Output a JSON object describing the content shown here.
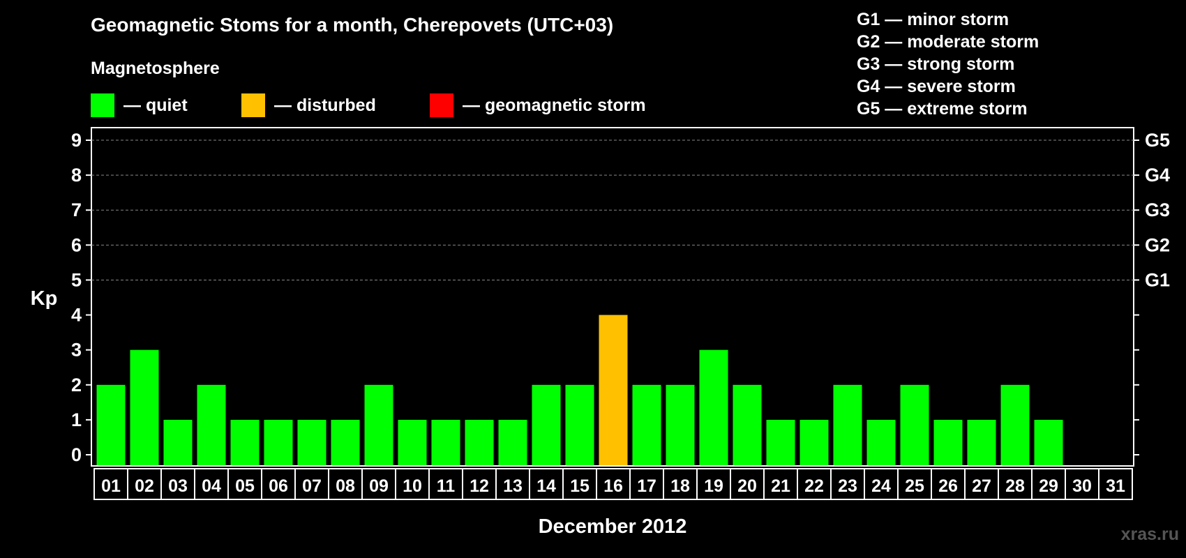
{
  "header": {
    "title": "Geomagnetic Stoms for a month, Cherepovets (UTC+03)",
    "subtitle": "Magnetosphere"
  },
  "legend": [
    {
      "label": "— quiet",
      "color": "#00ff00"
    },
    {
      "label": "— disturbed",
      "color": "#ffc000"
    },
    {
      "label": "— geomagnetic storm",
      "color": "#ff0000"
    }
  ],
  "storm_levels": [
    "G1 — minor storm",
    "G2 — moderate storm",
    "G3 — strong storm",
    "G4 — severe storm",
    "G5 — extreme storm"
  ],
  "watermark": "xras.ru",
  "chart_data": {
    "type": "bar",
    "title": "Geomagnetic Stoms for a month, Cherepovets (UTC+03)",
    "xlabel": "December 2012",
    "ylabel": "Kp",
    "ylim": [
      0,
      9
    ],
    "yticks": [
      "0",
      "1",
      "2",
      "3",
      "4",
      "5",
      "6",
      "7",
      "8",
      "9"
    ],
    "right_axis_labels": [
      {
        "kp": 5,
        "label": "G1"
      },
      {
        "kp": 6,
        "label": "G2"
      },
      {
        "kp": 7,
        "label": "G3"
      },
      {
        "kp": 8,
        "label": "G4"
      },
      {
        "kp": 9,
        "label": "G5"
      }
    ],
    "categories": [
      "01",
      "02",
      "03",
      "04",
      "05",
      "06",
      "07",
      "08",
      "09",
      "10",
      "11",
      "12",
      "13",
      "14",
      "15",
      "16",
      "17",
      "18",
      "19",
      "20",
      "21",
      "22",
      "23",
      "24",
      "25",
      "26",
      "27",
      "28",
      "29",
      "30",
      "31"
    ],
    "values": [
      2,
      3,
      1,
      2,
      1,
      1,
      1,
      1,
      2,
      1,
      1,
      1,
      1,
      2,
      2,
      4,
      2,
      2,
      3,
      2,
      1,
      1,
      2,
      1,
      2,
      1,
      1,
      2,
      1,
      null,
      null
    ],
    "colors": {
      "quiet": "#00ff00",
      "disturbed": "#ffc000",
      "storm": "#ff0000"
    },
    "grid": "dashed horizontal at Kp 5-9",
    "legend_position": "top"
  }
}
